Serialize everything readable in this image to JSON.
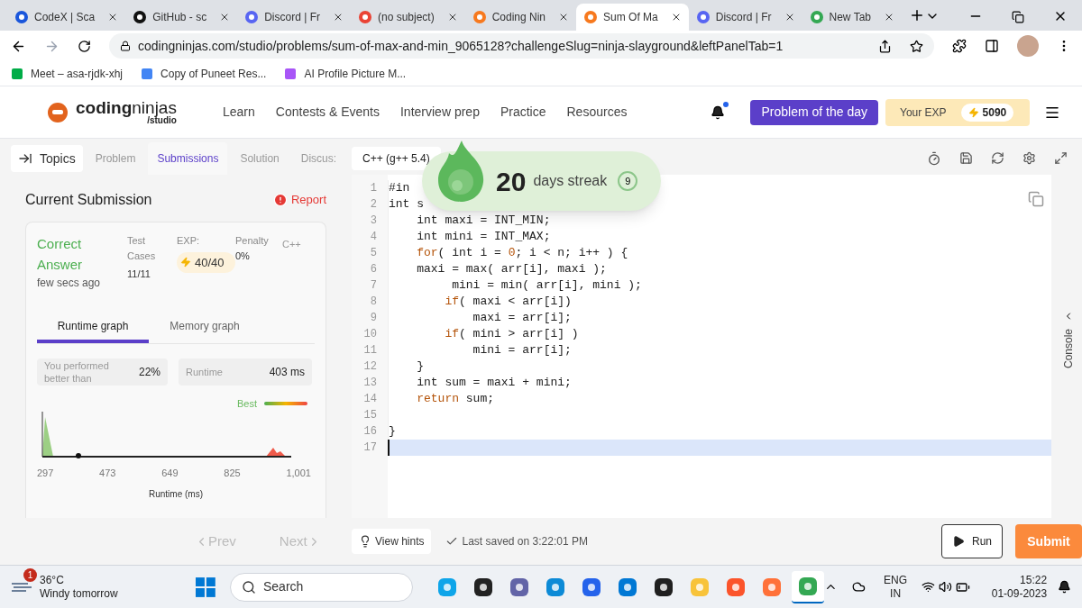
{
  "browser_tabs": [
    {
      "kind": "codex",
      "title": "CodeX | Sca",
      "selected": false
    },
    {
      "kind": "github",
      "title": "GitHub - sc",
      "selected": false
    },
    {
      "kind": "discord",
      "title": "Discord | Fr",
      "selected": false
    },
    {
      "kind": "gmail",
      "title": "(no subject)",
      "selected": false
    },
    {
      "kind": "ninjas",
      "title": "Coding Nin",
      "selected": false
    },
    {
      "kind": "ninjas",
      "title": "Sum Of Ma",
      "selected": true
    },
    {
      "kind": "discord",
      "title": "Discord | Fr",
      "selected": false
    },
    {
      "kind": "chrome",
      "title": "New Tab",
      "selected": false
    }
  ],
  "address": "codingninjas.com/studio/problems/sum-of-max-and-min_9065128?challengeSlug=ninja-slayground&leftPanelTab=1",
  "bookmarks": [
    {
      "kind": "meet",
      "label": "Meet – asa-rjdk-xhj"
    },
    {
      "kind": "docs",
      "label": "Copy of Puneet Res..."
    },
    {
      "kind": "person",
      "label": "AI Profile Picture M..."
    }
  ],
  "site": {
    "brand_bold": "coding",
    "brand_light": "ninjas",
    "sub": "/studio",
    "nav": [
      "Learn",
      "Contests & Events",
      "Interview prep",
      "Practice",
      "Resources"
    ],
    "notification_dot": true,
    "potd": "Problem of the day",
    "exp_label": "Your EXP",
    "exp": "5090"
  },
  "left_tabs": {
    "topics": "Topics",
    "tabs": [
      {
        "label": "Problem",
        "selected": false
      },
      {
        "label": "Submissions",
        "selected": true
      },
      {
        "label": "Solution",
        "selected": false
      },
      {
        "label": "Discus:",
        "selected": false
      }
    ]
  },
  "submission": {
    "title": "Current Submission",
    "report": "Report",
    "status": "Correct Answer",
    "time": "few secs ago",
    "test_label": "Test Cases",
    "tests": "11/11",
    "exp_label": "EXP:",
    "exp": "40/40",
    "penalty_label": "Penalty",
    "penalty": "0%",
    "lang": "C++",
    "graph_tabs": [
      {
        "label": "Runtime graph",
        "selected": true
      },
      {
        "label": "Memory graph",
        "selected": false
      }
    ],
    "better_label": "You performed better than",
    "better": "22%",
    "runtime_label": "Runtime",
    "runtime": "403 ms",
    "legend": "Best",
    "x_ticks": [
      "297",
      "473",
      "649",
      "825",
      "1,001"
    ],
    "x_label": "Runtime (ms)"
  },
  "editor": {
    "language": "C++ (g++ 5.4)",
    "lines": [
      {
        "selected": false,
        "segments": [
          {
            "kind": "plain",
            "text": "#in"
          }
        ]
      },
      {
        "selected": false,
        "segments": [
          {
            "kind": "plain",
            "text": "int s"
          }
        ]
      },
      {
        "selected": false,
        "segments": [
          {
            "kind": "plain",
            "text": "    int maxi = INT_MIN;"
          }
        ]
      },
      {
        "selected": false,
        "segments": [
          {
            "kind": "plain",
            "text": "    int mini = INT_MAX;"
          }
        ]
      },
      {
        "selected": false,
        "segments": [
          {
            "kind": "keyword",
            "text": "    for"
          },
          {
            "kind": "plain",
            "text": "( int i = "
          },
          {
            "kind": "number",
            "text": "0"
          },
          {
            "kind": "plain",
            "text": "; i < n; i++ ) {"
          }
        ]
      },
      {
        "selected": false,
        "segments": [
          {
            "kind": "plain",
            "text": "    maxi = max( arr[i], maxi );"
          }
        ]
      },
      {
        "selected": false,
        "segments": [
          {
            "kind": "plain",
            "text": "         mini = min( arr[i], mini );"
          }
        ]
      },
      {
        "selected": false,
        "segments": [
          {
            "kind": "keyword",
            "text": "        if"
          },
          {
            "kind": "plain",
            "text": "( maxi < arr[i])"
          }
        ]
      },
      {
        "selected": false,
        "segments": [
          {
            "kind": "plain",
            "text": "            maxi = arr[i];"
          }
        ]
      },
      {
        "selected": false,
        "segments": [
          {
            "kind": "keyword",
            "text": "        if"
          },
          {
            "kind": "plain",
            "text": "( mini > arr[i] )"
          }
        ]
      },
      {
        "selected": false,
        "segments": [
          {
            "kind": "plain",
            "text": "            mini = arr[i];"
          }
        ]
      },
      {
        "selected": false,
        "segments": [
          {
            "kind": "plain",
            "text": "    }"
          }
        ]
      },
      {
        "selected": false,
        "segments": [
          {
            "kind": "plain",
            "text": "    int sum = maxi + mini;"
          }
        ]
      },
      {
        "selected": false,
        "segments": [
          {
            "kind": "keyword",
            "text": "    return"
          },
          {
            "kind": "plain",
            "text": " sum;"
          }
        ]
      },
      {
        "selected": false
      },
      {
        "selected": false,
        "segments": [
          {
            "kind": "plain",
            "text": "}"
          }
        ]
      },
      {
        "selected": true
      }
    ],
    "line_numbers": [
      "1",
      "2",
      "3",
      "4",
      "5",
      "6",
      "7",
      "8",
      "9",
      "10",
      "11",
      "12",
      "13",
      "14",
      "15",
      "16",
      "17"
    ],
    "console": "Console"
  },
  "streak": {
    "days": "20",
    "label": "days streak",
    "count": "9"
  },
  "footer": {
    "prev": "Prev",
    "next": "Next",
    "hints": "View hints",
    "saved": "Last saved on 3:22:01 PM",
    "run": "Run",
    "submit": "Submit"
  },
  "taskbar": {
    "weather_badge": "1",
    "temp": "36°C",
    "forecast": "Windy tomorrow",
    "search": "Search",
    "apps": [
      {
        "kind": "photos",
        "selected": false
      },
      {
        "kind": "terminal-dark",
        "selected": false
      },
      {
        "kind": "teams",
        "selected": false
      },
      {
        "kind": "edge",
        "selected": false
      },
      {
        "kind": "store",
        "selected": false
      },
      {
        "kind": "help",
        "selected": false
      },
      {
        "kind": "console",
        "selected": false
      },
      {
        "kind": "folder",
        "selected": false
      },
      {
        "kind": "brave",
        "selected": false
      },
      {
        "kind": "firefox",
        "selected": false
      },
      {
        "kind": "chrome",
        "selected": true
      }
    ],
    "lang": "ENG",
    "region": "IN",
    "time": "15:22",
    "date": "01-09-2023"
  }
}
